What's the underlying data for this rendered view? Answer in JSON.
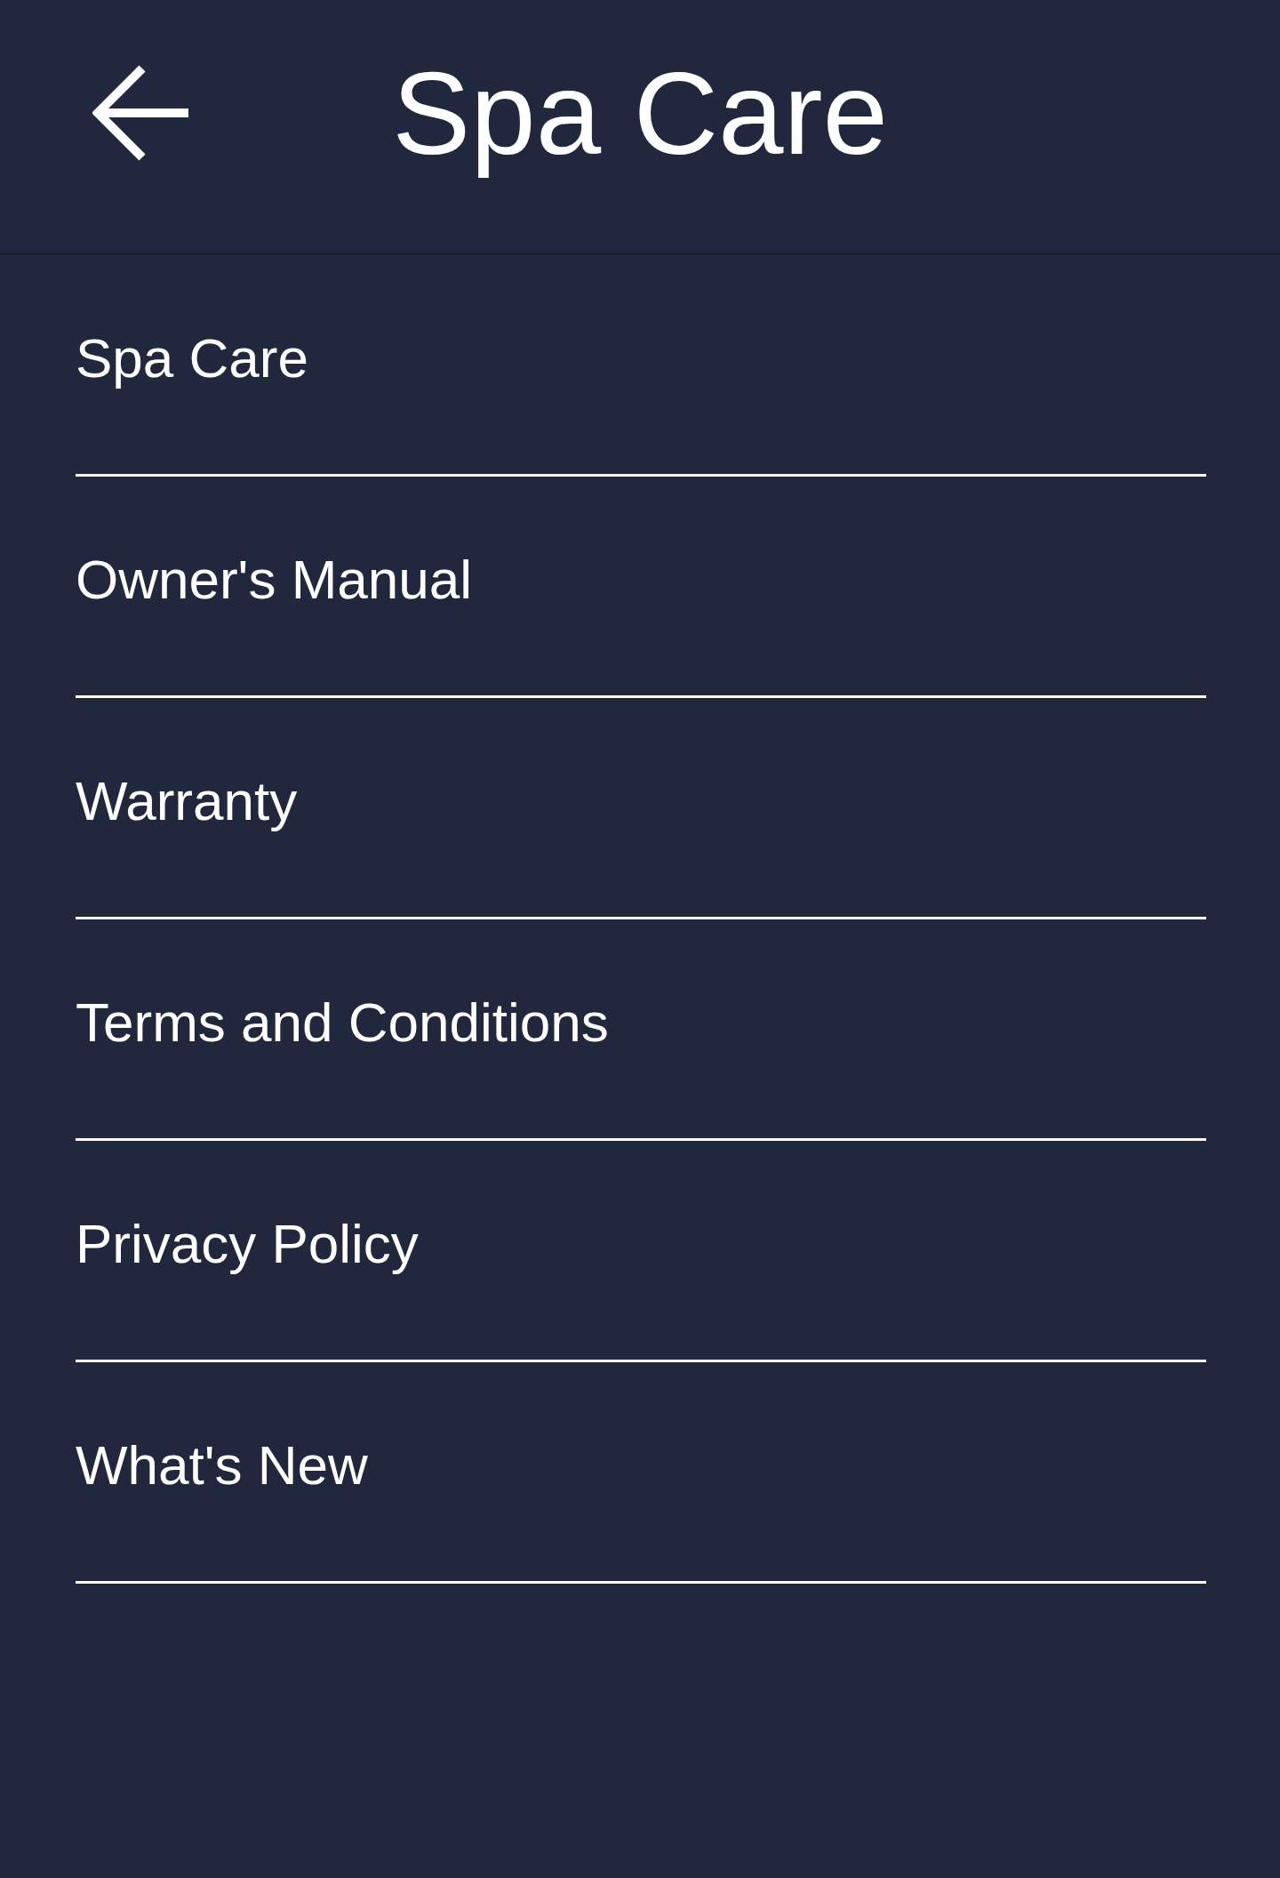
{
  "header": {
    "title": "Spa Care"
  },
  "menu": {
    "items": [
      {
        "label": "Spa Care"
      },
      {
        "label": "Owner's Manual"
      },
      {
        "label": "Warranty"
      },
      {
        "label": "Terms and Conditions"
      },
      {
        "label": "Privacy Policy"
      },
      {
        "label": "What's New"
      }
    ]
  }
}
